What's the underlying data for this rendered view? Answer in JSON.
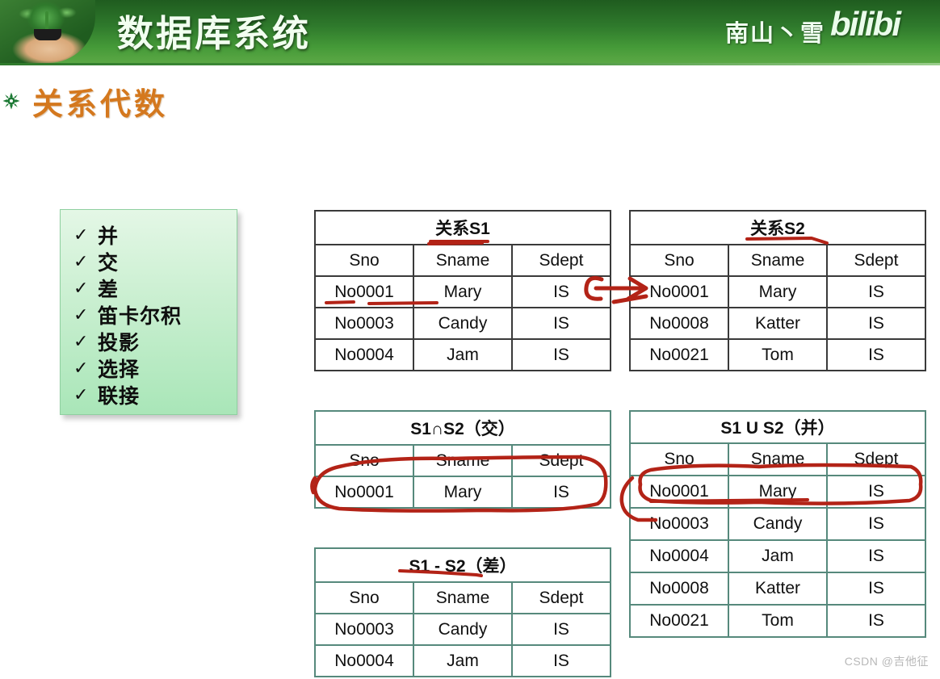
{
  "header": {
    "title": "数据库系统",
    "author": "南山丶雪",
    "platform_logo": "bilibi",
    "photo_icon": "sprout-in-hand-photo"
  },
  "slide": {
    "bullet_icon": "green-flower-bullet-icon",
    "title": "关系代数"
  },
  "checklist": {
    "check_icon": "check-mark-icon",
    "items": [
      {
        "label": "并"
      },
      {
        "label": "交"
      },
      {
        "label": "差"
      },
      {
        "label": "笛卡尔积"
      },
      {
        "label": "投影"
      },
      {
        "label": "选择"
      },
      {
        "label": "联接"
      }
    ]
  },
  "tables": {
    "s1": {
      "caption": "关系S1",
      "columns": [
        "Sno",
        "Sname",
        "Sdept"
      ],
      "rows": [
        [
          "No0001",
          "Mary",
          "IS"
        ],
        [
          "No0003",
          "Candy",
          "IS"
        ],
        [
          "No0004",
          "Jam",
          "IS"
        ]
      ]
    },
    "s2": {
      "caption": "关系S2",
      "columns": [
        "Sno",
        "Sname",
        "Sdept"
      ],
      "rows": [
        [
          "No0001",
          "Mary",
          "IS"
        ],
        [
          "No0008",
          "Katter",
          "IS"
        ],
        [
          "No0021",
          "Tom",
          "IS"
        ]
      ]
    },
    "intersection": {
      "caption": "S1∩S2（交）",
      "columns": [
        "Sno",
        "Sname",
        "Sdept"
      ],
      "rows": [
        [
          "No0001",
          "Mary",
          "IS"
        ]
      ]
    },
    "union": {
      "caption": "S1 U S2（并）",
      "columns": [
        "Sno",
        "Sname",
        "Sdept"
      ],
      "rows": [
        [
          "No0001",
          "Mary",
          "IS"
        ],
        [
          "No0003",
          "Candy",
          "IS"
        ],
        [
          "No0004",
          "Jam",
          "IS"
        ],
        [
          "No0008",
          "Katter",
          "IS"
        ],
        [
          "No0021",
          "Tom",
          "IS"
        ]
      ]
    },
    "difference": {
      "caption": "S1 - S2（差）",
      "columns": [
        "Sno",
        "Sname",
        "Sdept"
      ],
      "rows": [
        [
          "No0003",
          "Candy",
          "IS"
        ],
        [
          "No0004",
          "Jam",
          "IS"
        ]
      ]
    }
  },
  "annotations": {
    "ink_color": "#b32317",
    "marks": [
      "underline-under-s1-caption",
      "underline-above-sname-s1",
      "underline-under-no0001-mary-s1",
      "arrow-from-s1-to-s2-no0001",
      "underline-under-s2-caption",
      "oval-around-intersection-row",
      "oval-around-union-no0001-row",
      "line-under-union-no0001-row",
      "underline-under-difference-caption"
    ]
  },
  "watermark": {
    "text": "CSDN @吉他征"
  },
  "colors": {
    "header_green_dark": "#1f5c1f",
    "header_green_light": "#5ba845",
    "title_orange": "#d4781e",
    "checklist_green": "#a9e6b8",
    "table_border_dark": "#3a3a3a",
    "table_border_teal": "#56897c",
    "annotation_red": "#b32317"
  }
}
